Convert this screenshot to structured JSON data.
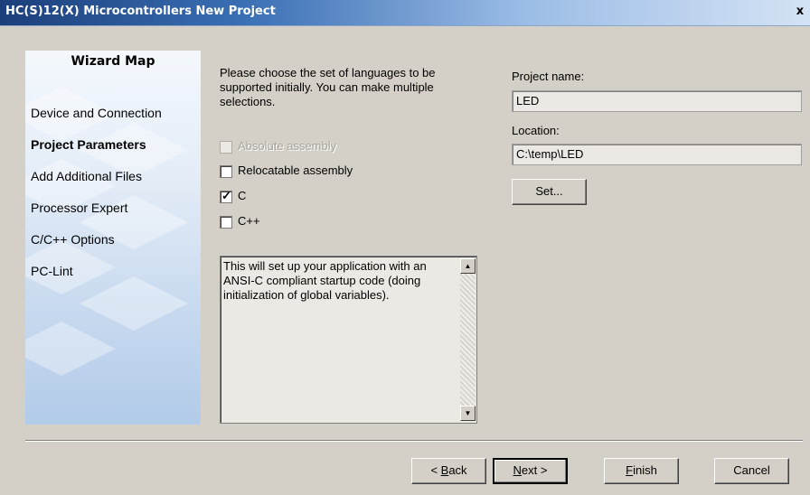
{
  "window": {
    "title": "HC(S)12(X) Microcontrollers New Project",
    "close_glyph": "x"
  },
  "wizard_map": {
    "title": "Wizard Map",
    "items": [
      {
        "label": "Device and Connection",
        "current": false
      },
      {
        "label": "Project Parameters",
        "current": true
      },
      {
        "label": "Add Additional Files",
        "current": false
      },
      {
        "label": "Processor Expert",
        "current": false
      },
      {
        "label": "C/C++ Options",
        "current": false
      },
      {
        "label": "PC-Lint",
        "current": false
      }
    ]
  },
  "languages": {
    "prompt": "Please choose the set of languages to be supported initially. You can make multiple selections.",
    "options": [
      {
        "label": "Absolute assembly",
        "checked": false,
        "enabled": false
      },
      {
        "label": "Relocatable assembly",
        "checked": false,
        "enabled": true
      },
      {
        "label": "C",
        "checked": true,
        "enabled": true
      },
      {
        "label": "C++",
        "checked": false,
        "enabled": true
      }
    ],
    "check_glyph": "✓"
  },
  "description": {
    "text": "This will set up your application with an ANSI-C compliant startup code (doing initialization of global variables)."
  },
  "project": {
    "name_label": "Project name:",
    "name_value": "LED",
    "location_label": "Location:",
    "location_value": "C:\\temp\\LED",
    "set_button_label": "Set..."
  },
  "buttons": {
    "back_label": "< Back",
    "back_mnemonic": "B",
    "next_label": "Next >",
    "next_mnemonic": "N",
    "finish_label": "Finish",
    "finish_mnemonic": "F",
    "cancel_label": "Cancel"
  }
}
